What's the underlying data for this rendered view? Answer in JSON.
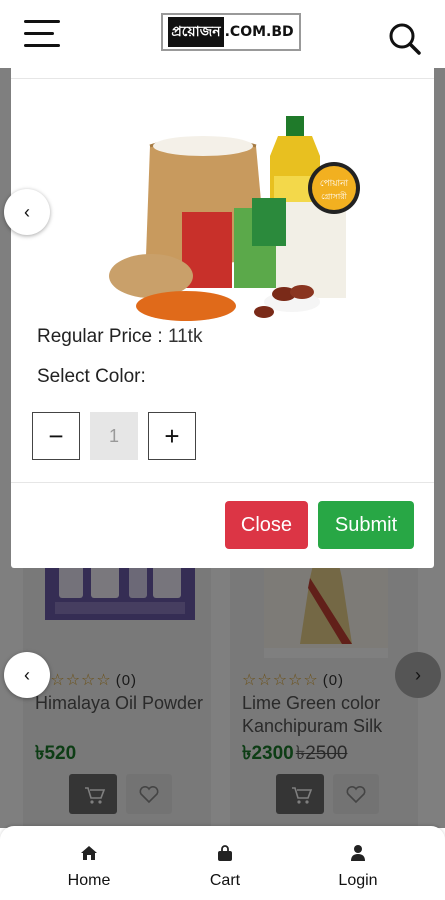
{
  "header": {
    "logo_bn": "প্রয়োজন",
    "logo_en": ".COM.BD"
  },
  "products": [
    {
      "rating_count": "(0)",
      "name": "Himalaya Oil Powder",
      "price": "৳520",
      "old_price": ""
    },
    {
      "rating_count": "(0)",
      "name": "Lime Green color Kanchipuram Silk",
      "price": "৳2300",
      "old_price": "৳2500"
    }
  ],
  "modal": {
    "regular_price_label": "Regular Price :",
    "regular_price_value": "11tk",
    "select_color_label": "Select Color:",
    "quantity_value": "1",
    "minus": "−",
    "plus": "+",
    "close_label": "Close",
    "submit_label": "Submit",
    "product_image_tag_line1": "পোয়ানা",
    "product_image_tag_line2": "গ্রোসারী"
  },
  "bottom_nav": {
    "items": [
      {
        "label": "Home",
        "icon": "home-icon"
      },
      {
        "label": "Cart",
        "icon": "bag-icon"
      },
      {
        "label": "Login",
        "icon": "user-icon"
      }
    ]
  },
  "colors": {
    "close": "#dc3545",
    "submit": "#28a745",
    "price_green": "#1a7a2a",
    "star": "#d8a12a"
  }
}
